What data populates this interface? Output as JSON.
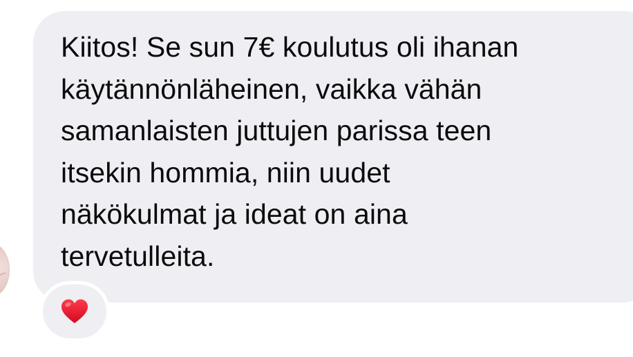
{
  "message": {
    "lines": [
      "Kiitos! Se sun 7€ koulutus oli ihanan",
      "käytännönläheinen, vaikka vähän",
      "samanlaisten juttujen parissa teen",
      "itsekin hommia, niin uudet",
      "näkökulmat ja ideat on aina",
      "tervetulleita."
    ]
  },
  "reaction": {
    "icon": "heart-icon",
    "color": "#e0102b"
  },
  "colors": {
    "bubble": "#eeeef3",
    "text": "#0b0b0d",
    "background": "#ffffff"
  }
}
